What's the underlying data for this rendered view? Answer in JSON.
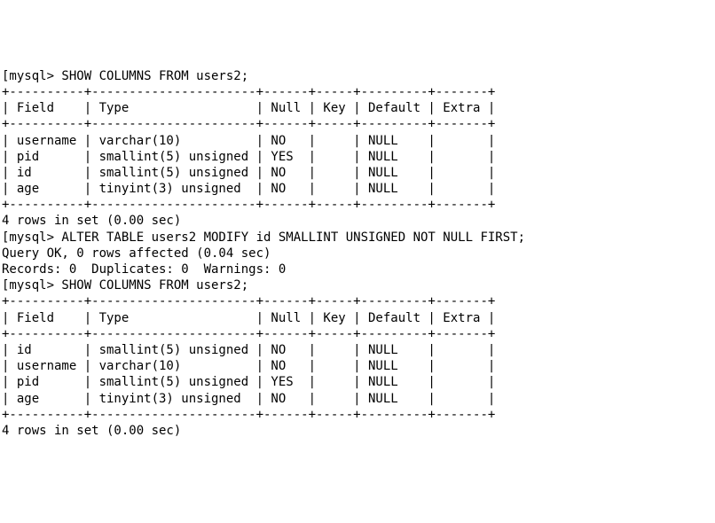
{
  "chart_data": {
    "type": "table",
    "before": {
      "columns": [
        "Field",
        "Type",
        "Null",
        "Key",
        "Default",
        "Extra"
      ],
      "rows": [
        [
          "username",
          "varchar(10)",
          "NO",
          "",
          "NULL",
          ""
        ],
        [
          "pid",
          "smallint(5) unsigned",
          "YES",
          "",
          "NULL",
          ""
        ],
        [
          "id",
          "smallint(5) unsigned",
          "NO",
          "",
          "NULL",
          ""
        ],
        [
          "age",
          "tinyint(3) unsigned",
          "NO",
          "",
          "NULL",
          ""
        ]
      ]
    },
    "after": {
      "columns": [
        "Field",
        "Type",
        "Null",
        "Key",
        "Default",
        "Extra"
      ],
      "rows": [
        [
          "id",
          "smallint(5) unsigned",
          "NO",
          "",
          "NULL",
          ""
        ],
        [
          "username",
          "varchar(10)",
          "NO",
          "",
          "NULL",
          ""
        ],
        [
          "pid",
          "smallint(5) unsigned",
          "YES",
          "",
          "NULL",
          ""
        ],
        [
          "age",
          "tinyint(3) unsigned",
          "NO",
          "",
          "NULL",
          ""
        ]
      ]
    }
  },
  "terminal": {
    "prompt": "[mysql> ",
    "widths": {
      "field": 10,
      "type": 22,
      "null": 6,
      "key": 5,
      "default": 9,
      "extra": 7
    },
    "blocks": [
      {
        "kind": "cmd",
        "text": "SHOW COLUMNS FROM users2;"
      },
      {
        "kind": "table",
        "data": "before"
      },
      {
        "kind": "summary",
        "text": "4 rows in set (0.00 sec)"
      },
      {
        "kind": "blank"
      },
      {
        "kind": "cmd",
        "text": "ALTER TABLE users2 MODIFY id SMALLINT UNSIGNED NOT NULL FIRST;"
      },
      {
        "kind": "text",
        "text": "Query OK, 0 rows affected (0.04 sec)"
      },
      {
        "kind": "text",
        "text": "Records: 0  Duplicates: 0  Warnings: 0"
      },
      {
        "kind": "blank"
      },
      {
        "kind": "cmd",
        "text": "SHOW COLUMNS FROM users2;"
      },
      {
        "kind": "table",
        "data": "after"
      },
      {
        "kind": "summary_cut",
        "text": "4 rows in set (0.00 sec)"
      }
    ]
  }
}
